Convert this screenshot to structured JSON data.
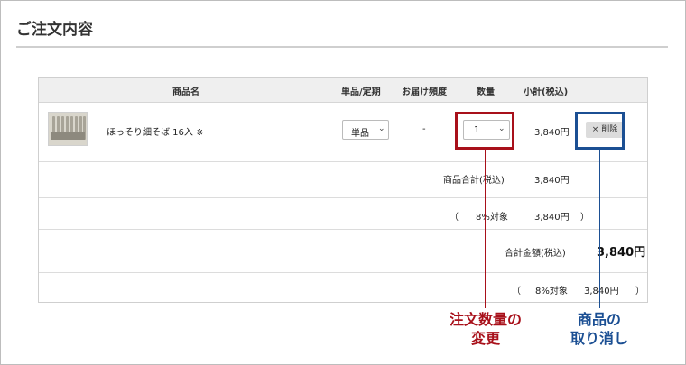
{
  "page": {
    "title": "ご注文内容"
  },
  "table": {
    "headers": {
      "product": "商品名",
      "type": "単品/定期",
      "frequency": "お届け頻度",
      "quantity": "数量",
      "subtotal": "小計(税込)"
    },
    "item": {
      "name": "ほっそり細そば 16入 ※",
      "type_selected": "単品",
      "frequency": "-",
      "quantity_selected": "1",
      "subtotal": "3,840円",
      "delete_label": "× 削除"
    },
    "summary": {
      "product_total_label": "商品合計(税込)",
      "product_total_value": "3,840円",
      "tax_open": "（",
      "tax_rate_label": "8%対象",
      "tax_value": "3,840円",
      "tax_close": "）",
      "grand_total_label": "合計金額(税込)",
      "grand_total_value": "3,840円",
      "tax2_open": "（",
      "tax2_rate_label": "8%対象",
      "tax2_value": "3,840円",
      "tax2_close": "）"
    }
  },
  "annotations": {
    "quantity_change": {
      "line1": "注文数量の",
      "line2": "変更",
      "color": "#a8101a"
    },
    "remove_item": {
      "line1": "商品の",
      "line2": "取り消し",
      "color": "#1b4f93"
    }
  },
  "icons": {
    "select_chevron": "chevron-down-icon",
    "product_image": "product-thumbnail"
  }
}
